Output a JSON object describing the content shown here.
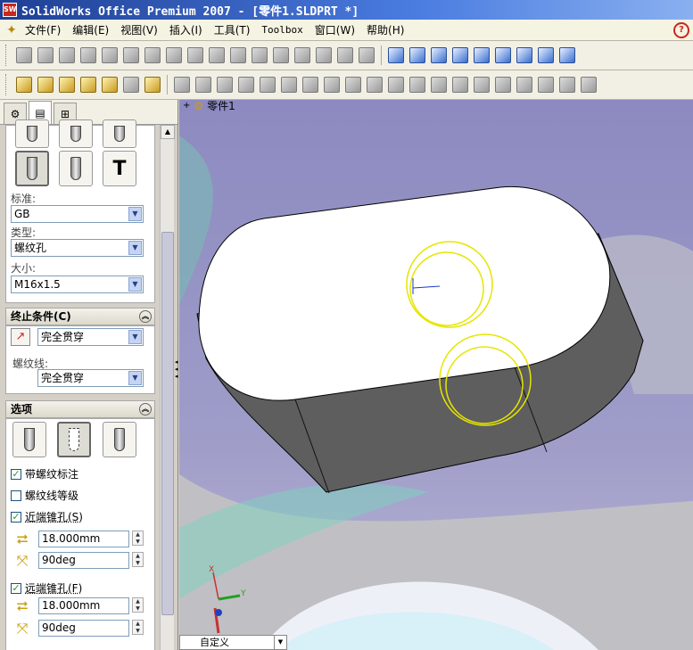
{
  "window": {
    "title": "SolidWorks Office Premium 2007 - [零件1.SLDPRT *]",
    "app_icon": "SW"
  },
  "menu": {
    "items": [
      "文件(F)",
      "编辑(E)",
      "视图(V)",
      "插入(I)",
      "工具(T)",
      "Toolbox",
      "窗口(W)",
      "帮助(H)"
    ]
  },
  "tree": {
    "root_label": "零件1",
    "expander": "+"
  },
  "panel": {
    "tabs": [
      "feature-manager",
      "property-manager",
      "configuration-manager"
    ],
    "standard_label": "标准:",
    "standard_value": "GB",
    "type_label": "类型:",
    "type_value": "螺纹孔",
    "size_label": "大小:",
    "size_value": "M16x1.5",
    "end_condition_title": "终止条件(C)",
    "end_condition_value": "完全贯穿",
    "thread_label": "螺纹线:",
    "thread_value": "完全贯穿",
    "options_title": "选项",
    "checkbox_cosmetic": {
      "label": "带螺纹标注",
      "checked": true
    },
    "checkbox_thread_class": {
      "label": "螺纹线等级",
      "checked": false
    },
    "checkbox_near_csk": {
      "label": "近端锥孔(S)",
      "checked": true
    },
    "near_diameter": "18.000mm",
    "near_angle": "90deg",
    "checkbox_far_csk": {
      "label": "远端锥孔(F)",
      "checked": true
    },
    "far_diameter": "18.000mm",
    "far_angle": "90deg",
    "check_mark": "✓"
  },
  "viewport": {
    "view_name": "自定义",
    "triad": {
      "x": "X",
      "y": "Y"
    }
  },
  "colors": {
    "sketch_circle": "#e6e600",
    "model_top": "#ffffff",
    "model_side": "#5a5a5a",
    "background": "#9a98c8"
  }
}
